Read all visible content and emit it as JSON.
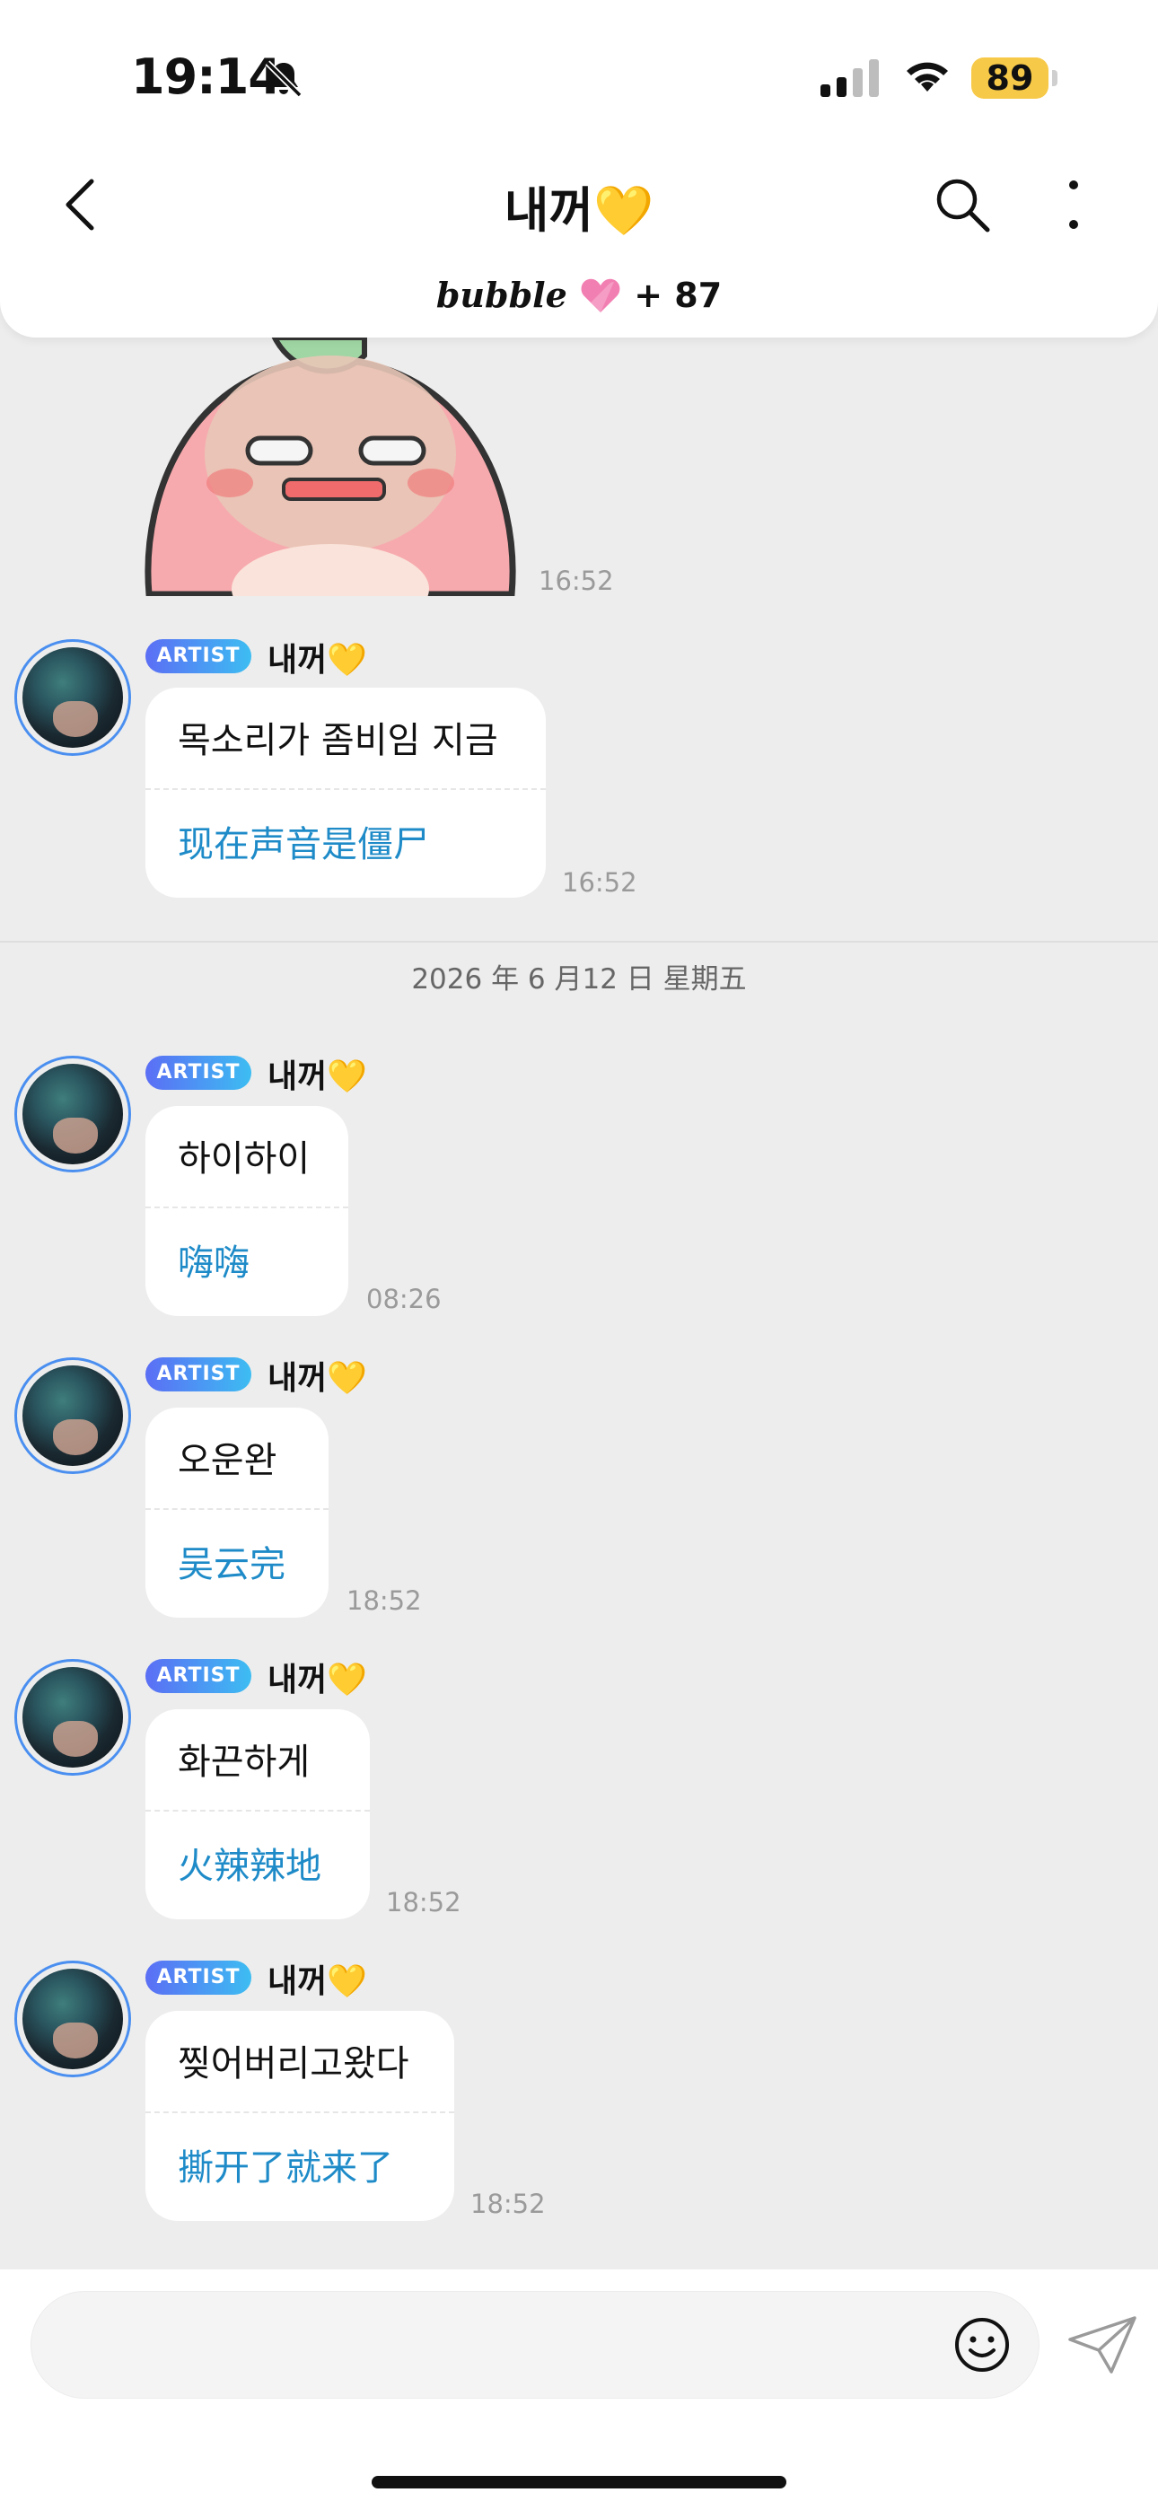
{
  "status_bar": {
    "time": "19:14",
    "battery": "89",
    "icons": [
      "bell-slash-icon",
      "cellular-signal-icon",
      "wifi-icon",
      "battery-icon"
    ]
  },
  "header": {
    "title": "내꺼💛",
    "subtitle_brand": "bubble",
    "subtitle_count": "+ 87",
    "icons": [
      "back-chevron-icon",
      "search-icon",
      "more-vertical-icon",
      "heart-icon"
    ]
  },
  "sticker": {
    "timestamp": "16:52",
    "icon": "peach-sticker"
  },
  "messages": [
    {
      "badge": "ARTIST",
      "sender": "내꺼💛",
      "text": "목소리가 좀비임 지금",
      "translation": "现在声音是僵尸",
      "timestamp": "16:52"
    },
    {
      "badge": "ARTIST",
      "sender": "내꺼💛",
      "text": "하이하이",
      "translation": "嗨嗨",
      "timestamp": "08:26"
    },
    {
      "badge": "ARTIST",
      "sender": "내꺼💛",
      "text": "오운완",
      "translation": "吴云完",
      "timestamp": "18:52"
    },
    {
      "badge": "ARTIST",
      "sender": "내꺼💛",
      "text": "화끈하게",
      "translation": "火辣辣地",
      "timestamp": "18:52"
    },
    {
      "badge": "ARTIST",
      "sender": "내꺼💛",
      "text": "찢어버리고왔다",
      "translation": "撕开了就来了",
      "timestamp": "18:52"
    }
  ],
  "date_separator": "2026 年 6 月12 日 星期五",
  "input": {
    "placeholder": "",
    "icons": [
      "emoji-icon",
      "send-icon"
    ]
  },
  "colors": {
    "accent_blue": "#1e8bc8",
    "badge_start": "#5b6ef5",
    "badge_end": "#3dbdf2",
    "battery": "#f7c948",
    "background": "#ededed"
  }
}
